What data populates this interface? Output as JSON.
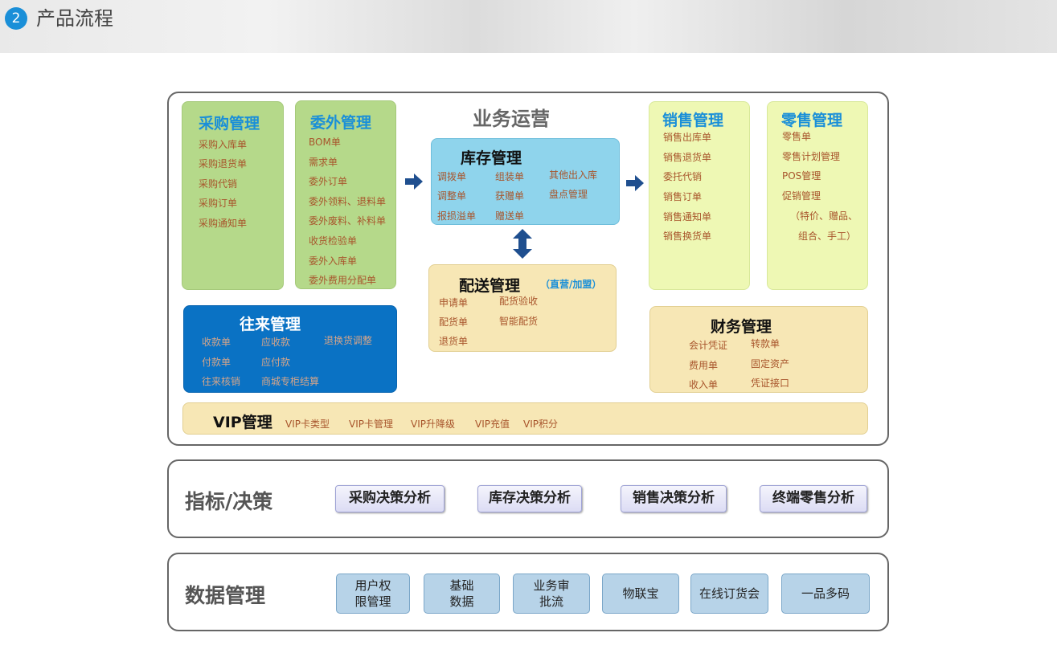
{
  "header": {
    "step": "2",
    "title": "产品流程"
  },
  "business": {
    "title": "业务运营",
    "purchase": {
      "title": "采购管理",
      "items": [
        "采购入库单",
        "采购退货单",
        "采购代销",
        "采购订单",
        "采购通知单"
      ]
    },
    "outsource": {
      "title": "委外管理",
      "items": [
        "BOM单",
        "需求单",
        "委外订单",
        "委外领料、退料单",
        "委外废料、补料单",
        "收货检验单",
        "委外入库单",
        "委外费用分配单"
      ]
    },
    "inventory": {
      "title": "库存管理",
      "items": [
        "调拨单",
        "组装单",
        "其他出入库",
        "调整单",
        "获赠单",
        "盘点管理",
        "报损溢单",
        "赠送单"
      ]
    },
    "distribution": {
      "title": "配送管理",
      "subtitle": "（直营/加盟）",
      "items": [
        "申请单",
        "配货验收",
        "配货单",
        "智能配货",
        "退货单"
      ]
    },
    "sales": {
      "title": "销售管理",
      "items": [
        "销售出库单",
        "销售退货单",
        "委托代销",
        "销售订单",
        "销售通知单",
        "销售换货单"
      ]
    },
    "retail": {
      "title": "零售管理",
      "items": [
        "零售单",
        "零售计划管理",
        "POS管理",
        "促销管理",
        "（特价、赠品、",
        "组合、手工）"
      ]
    },
    "accounts": {
      "title": "往来管理",
      "items": [
        "收款单",
        "应收款",
        "退换货调整",
        "付款单",
        "应付款",
        "往来核销",
        "商城专柜结算"
      ]
    },
    "finance": {
      "title": "财务管理",
      "items": [
        "会计凭证",
        "转款单",
        "费用单",
        "固定资产",
        "收入单",
        "凭证接口"
      ]
    },
    "vip": {
      "title": "VIP管理",
      "items": [
        "VIP卡类型",
        "VIP卡管理",
        "VIP升降级",
        "VIP充值",
        "VIP积分"
      ]
    }
  },
  "decision": {
    "title": "指标/决策",
    "items": [
      "采购决策分析",
      "库存决策分析",
      "销售决策分析",
      "终端零售分析"
    ]
  },
  "data_mgmt": {
    "title": "数据管理",
    "items": [
      "用户权\n限管理",
      "基础\n数据",
      "业务审\n批流",
      "物联宝",
      "在线订货会",
      "一品多码"
    ]
  },
  "colors": {
    "accent": "#1a8fd8",
    "arrow": "#1f4f8f",
    "item_text": "#a8552c"
  }
}
